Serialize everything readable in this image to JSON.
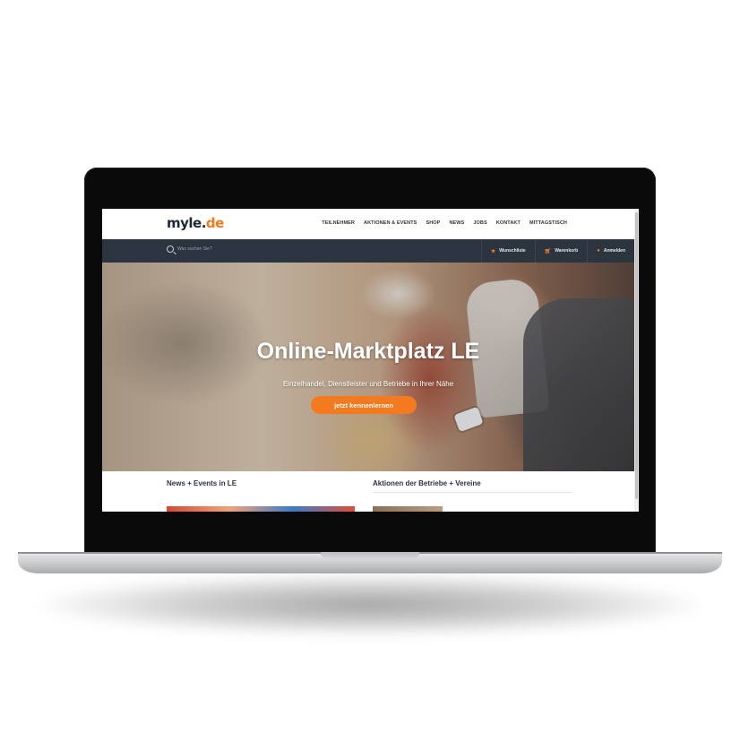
{
  "site": {
    "logo_main": "myle.",
    "logo_accent": "de"
  },
  "nav": {
    "items": [
      {
        "label": "TEILNEHMER"
      },
      {
        "label": "AKTIONEN & EVENTS"
      },
      {
        "label": "SHOP"
      },
      {
        "label": "NEWS"
      },
      {
        "label": "JOBS"
      },
      {
        "label": "KONTAKT"
      },
      {
        "label": "MITTAGSTISCH"
      }
    ]
  },
  "search": {
    "placeholder": "Was suchen Sie?",
    "icon": "search-icon"
  },
  "subnav": {
    "wishlist": {
      "label": "Wunschliste",
      "icon": "star-icon"
    },
    "cart": {
      "label": "Warenkorb",
      "icon": "cart-icon"
    },
    "login": {
      "label": "Anmelden",
      "icon": "user-icon"
    }
  },
  "hero": {
    "title": "Online-Marktplatz LE",
    "subtitle": "Einzelhandel, Dienstleister und Betriebe in Ihrer Nähe",
    "cta": "jetzt kennenlernen"
  },
  "sections": {
    "news_title": "News + Events in LE",
    "actions_title": "Aktionen der Betriebe + Vereine"
  },
  "colors": {
    "accent": "#f47a20",
    "navy": "#2c3440"
  }
}
